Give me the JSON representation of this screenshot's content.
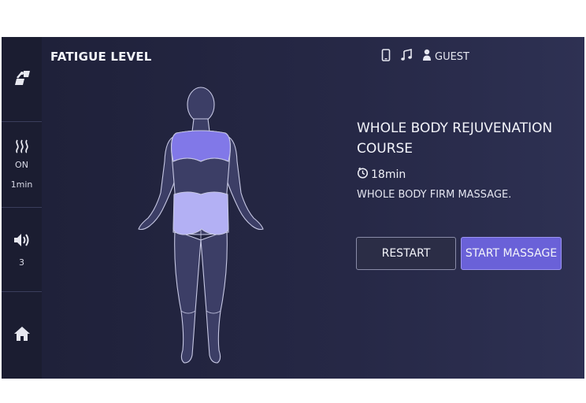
{
  "header": {
    "title": "FATIGUE LEVEL",
    "guest_label": "GUEST"
  },
  "sidebar": {
    "heat_state": "ON",
    "heat_time": "1min",
    "volume_level": "3"
  },
  "course": {
    "title": "WHOLE BODY REJUVENATION COURSE",
    "duration": "18min",
    "description": "WHOLE BODY FIRM MASSAGE."
  },
  "buttons": {
    "restart": "RESTART",
    "start": "START MASSAGE"
  },
  "colors": {
    "accent": "#6a61d8",
    "highlight_upper": "#8178e8",
    "highlight_lower": "#b3b0f4",
    "body": "#3c3e66"
  }
}
